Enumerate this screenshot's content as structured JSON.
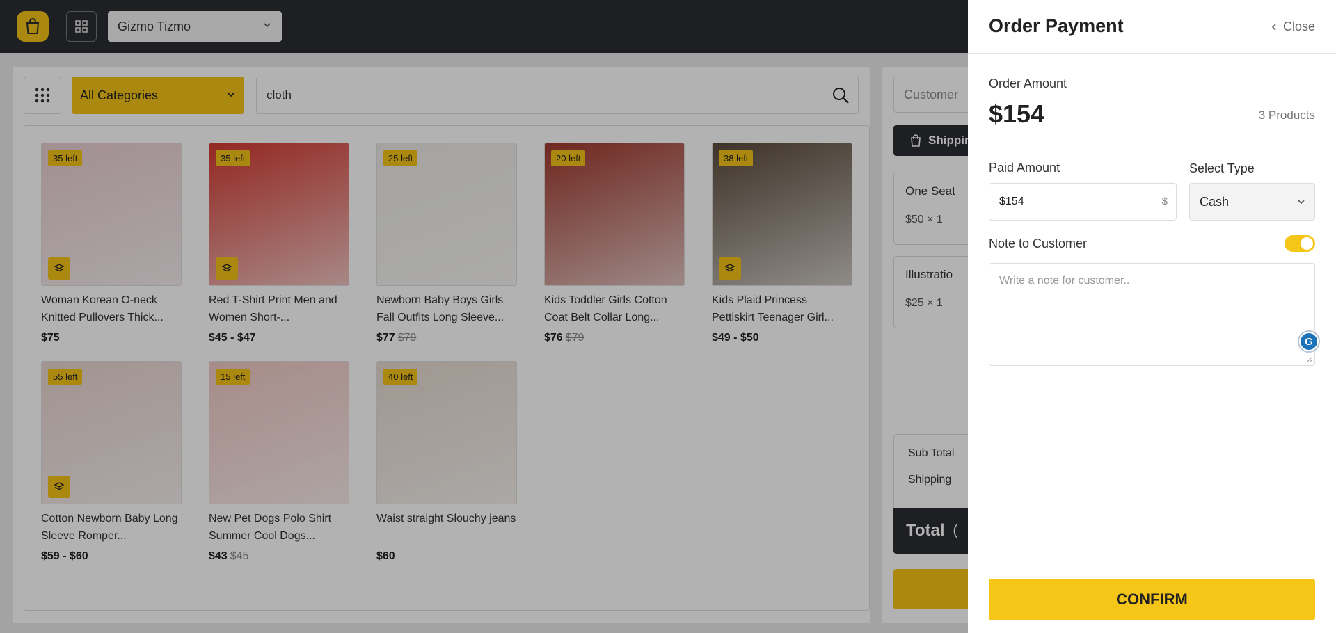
{
  "topbar": {
    "store_name": "Gizmo Tizmo"
  },
  "toolbar": {
    "category": "All Categories",
    "search_value": "cloth"
  },
  "products": [
    {
      "stock": "35 left",
      "name": "Woman Korean O-neck Knitted Pullovers Thick...",
      "price": "$75",
      "old_price": "",
      "has_variants": true,
      "color": "#e9cdd0"
    },
    {
      "stock": "35 left",
      "name": "Red T-Shirt Print Men and Women Short-...",
      "price": "$45 - $47",
      "old_price": "",
      "has_variants": true,
      "color": "#d43a32"
    },
    {
      "stock": "25 left",
      "name": "Newborn Baby Boys Girls Fall Outfits Long Sleeve...",
      "price": "$77",
      "old_price": "$79",
      "has_variants": false,
      "color": "#eceae6"
    },
    {
      "stock": "20 left",
      "name": "Kids Toddler Girls Cotton Coat Belt Collar Long...",
      "price": "$76",
      "old_price": "$79",
      "has_variants": false,
      "color": "#a0392e"
    },
    {
      "stock": "38 left",
      "name": "Kids Plaid Princess Pettiskirt Teenager Girl...",
      "price": "$49 - $50",
      "old_price": "",
      "has_variants": true,
      "color": "#5a4a3a"
    },
    {
      "stock": "55 left",
      "name": "Cotton Newborn Baby Long Sleeve Romper...",
      "price": "$59 - $60",
      "old_price": "",
      "has_variants": true,
      "color": "#e8d4cf"
    },
    {
      "stock": "15 left",
      "name": "New Pet Dogs Polo Shirt Summer Cool Dogs...",
      "price": "$43",
      "old_price": "$45",
      "has_variants": false,
      "color": "#f0c8c4"
    },
    {
      "stock": "40 left",
      "name": "Waist straight Slouchy jeans",
      "price": "$60",
      "old_price": "",
      "has_variants": false,
      "color": "#e6d9cf"
    }
  ],
  "cart": {
    "customer_placeholder": "Customer",
    "shipping_label": "Shipping",
    "items": [
      {
        "name": "One Seat",
        "qty": "$50 × 1"
      },
      {
        "name": "Illustratio",
        "qty": "$25 × 1"
      }
    ],
    "subtotal_label": "Sub Total",
    "shipping_row_label": "Shipping",
    "total_label": "Total",
    "total_suffix": "("
  },
  "drawer": {
    "title": "Order Payment",
    "close_label": "Close",
    "order_amount_label": "Order Amount",
    "order_amount": "$154",
    "products_count": "3 Products",
    "paid_amount_label": "Paid Amount",
    "paid_amount_value": "$154",
    "currency_symbol": "$",
    "select_type_label": "Select Type",
    "payment_type": "Cash",
    "note_label": "Note to Customer",
    "note_placeholder": "Write a note for customer..",
    "confirm_label": "CONFIRM"
  },
  "colors": {
    "accent": "#f5c518",
    "dark": "#2b2d31"
  }
}
